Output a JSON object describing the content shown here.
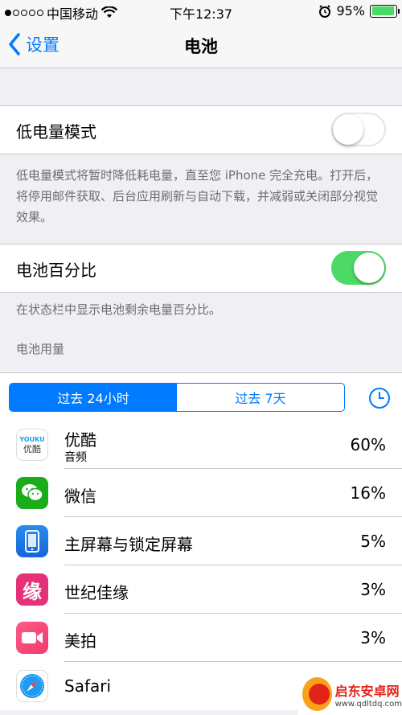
{
  "status_bar": {
    "carrier": "中国移动",
    "time": "下午12:37",
    "battery_percent": "95%",
    "battery_level": 0.95,
    "icons": [
      "signal-dots-icon",
      "wifi-icon",
      "alarm-icon",
      "battery-icon"
    ]
  },
  "nav": {
    "back_label": "设置",
    "title": "电池"
  },
  "low_power": {
    "label": "低电量模式",
    "enabled": false,
    "footnote": "低电量模式将暂时降低耗电量，直至您 iPhone 完全充电。打开后，将停用邮件获取、后台应用刷新与自动下载，并减弱或关闭部分视觉效果。"
  },
  "battery_percentage": {
    "label": "电池百分比",
    "enabled": true,
    "footnote": "在状态栏中显示电池剩余电量百分比。"
  },
  "usage": {
    "section_header": "电池用量",
    "segments": [
      "过去 24小时",
      "过去 7天"
    ],
    "selected_segment": 0,
    "apps": [
      {
        "name": "优酷",
        "subtitle": "音频",
        "percent": "60%",
        "icon": "youku-icon"
      },
      {
        "name": "微信",
        "subtitle": "",
        "percent": "16%",
        "icon": "wechat-icon"
      },
      {
        "name": "主屏幕与锁定屏幕",
        "subtitle": "",
        "percent": "5%",
        "icon": "home-lock-screen-icon"
      },
      {
        "name": "世纪佳缘",
        "subtitle": "",
        "percent": "3%",
        "icon": "jiayuan-icon"
      },
      {
        "name": "美拍",
        "subtitle": "",
        "percent": "3%",
        "icon": "meipai-icon"
      },
      {
        "name": "Safari",
        "subtitle": "",
        "percent": "",
        "icon": "safari-icon"
      }
    ],
    "youku_icon_text": [
      "YOUKU",
      "优酷"
    ],
    "jiayuan_icon_text": "缘"
  },
  "watermark": {
    "title": "启东安卓网",
    "url": "www.qdltdq.com"
  },
  "colors": {
    "accent": "#007aff",
    "toggle_on": "#4cd964",
    "background": "#efeff4"
  }
}
